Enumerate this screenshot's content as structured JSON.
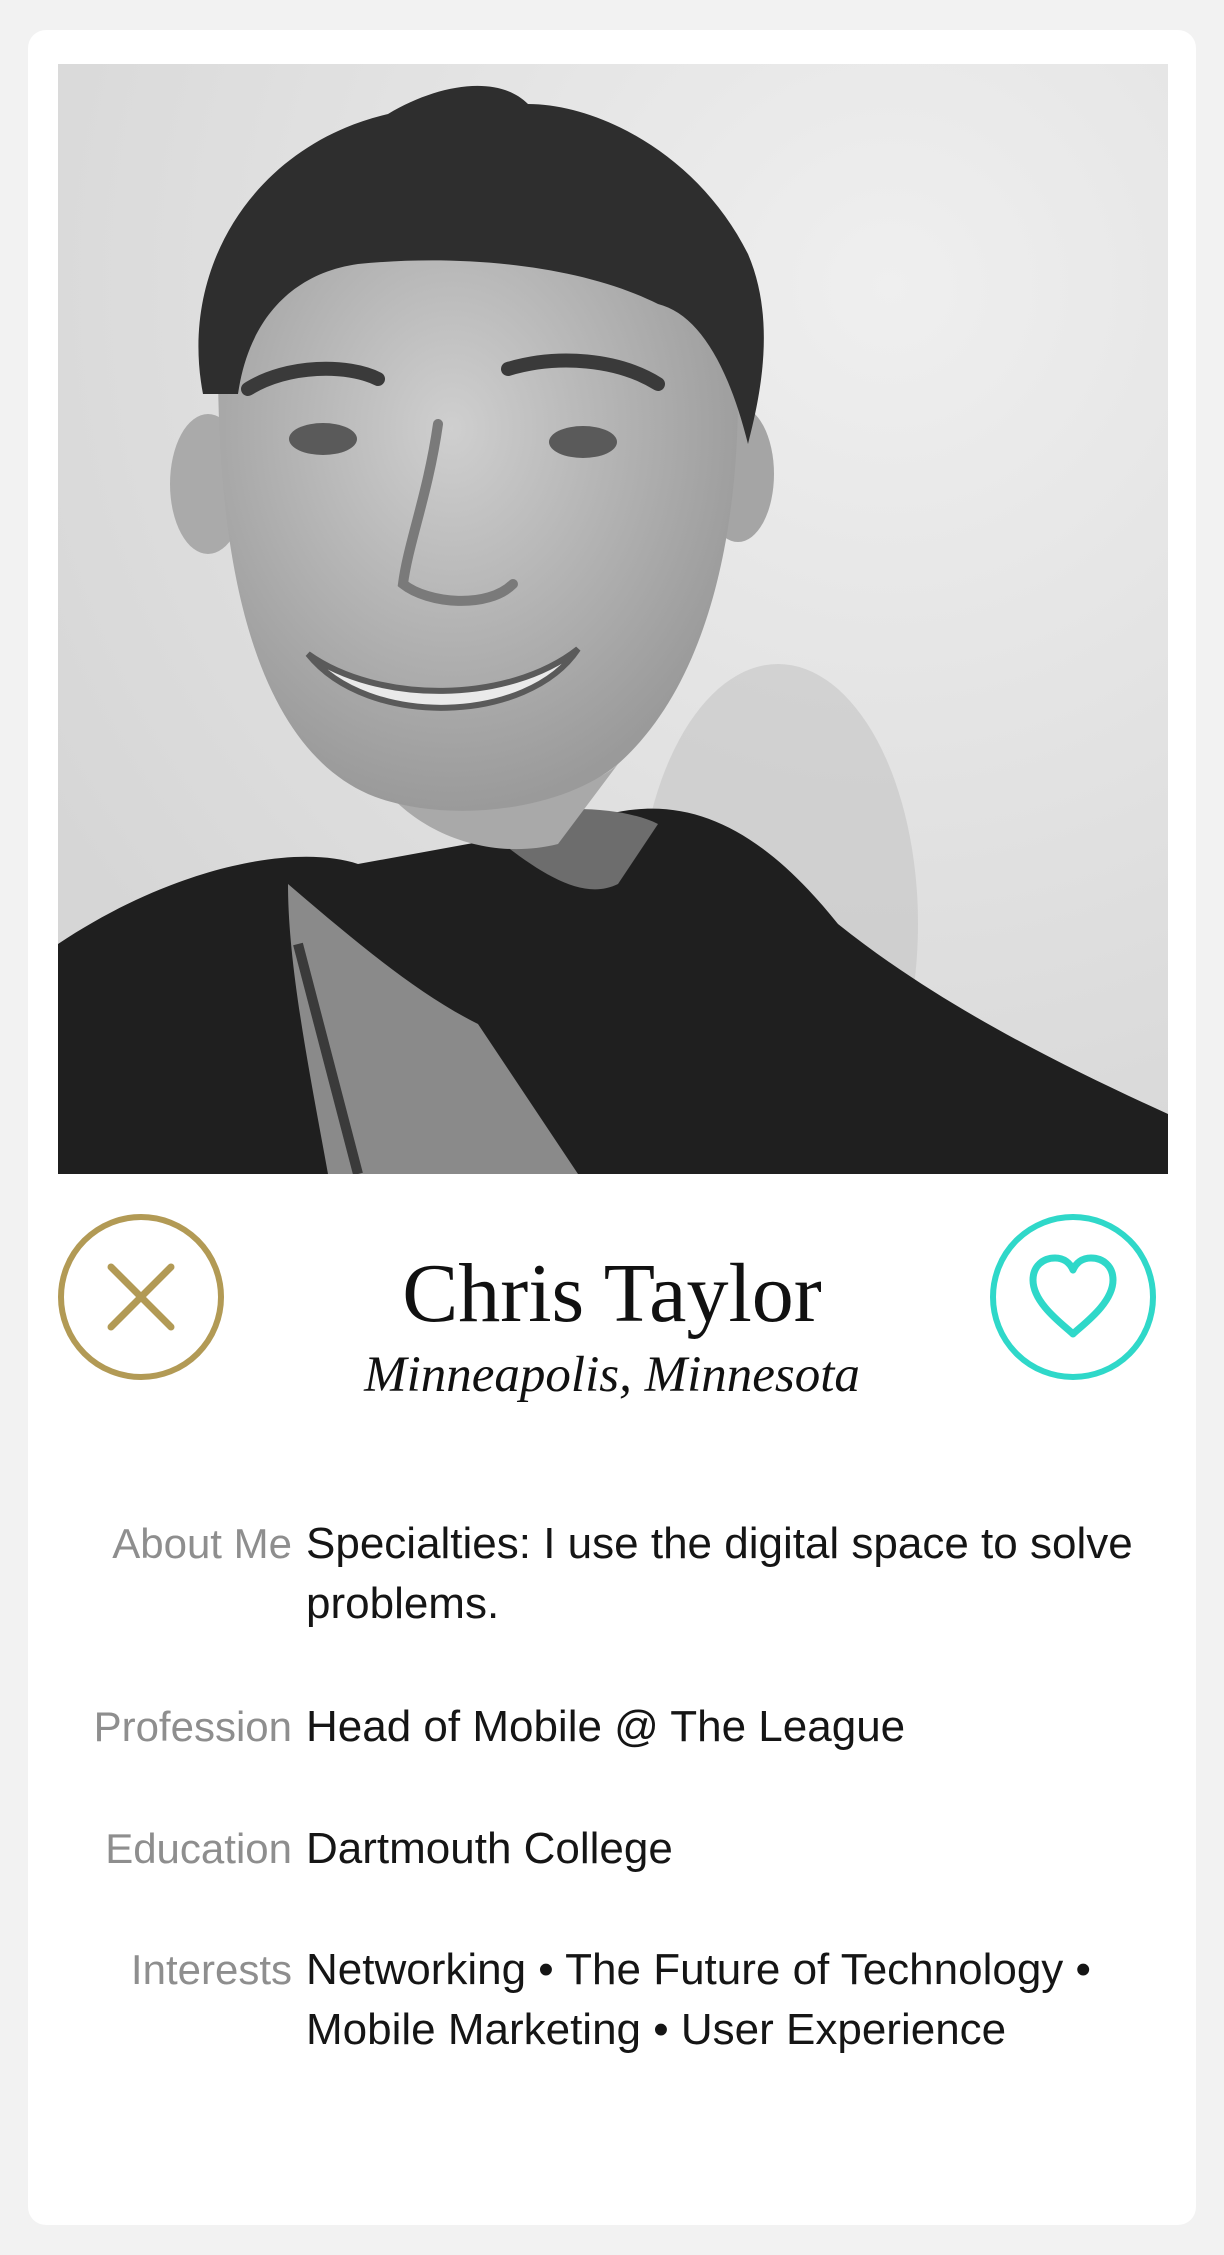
{
  "profile": {
    "name": "Chris Taylor",
    "location": "Minneapolis, Minnesota"
  },
  "actions": {
    "pass_icon": "close-icon",
    "like_icon": "heart-icon",
    "pass_color": "#b29a55",
    "like_color": "#2fd8c9"
  },
  "details": [
    {
      "label": "About Me",
      "value": "Specialties: I use the digital space to solve problems."
    },
    {
      "label": "Profession",
      "value": "Head of Mobile @ The League"
    },
    {
      "label": "Education",
      "value": "Dartmouth College"
    },
    {
      "label": "Interests",
      "value": "Networking • The Future of Technology • Mobile Marketing • User Experience"
    }
  ],
  "colors": {
    "background": "#f2f2f2",
    "card": "#ffffff",
    "label": "#8e8e8e",
    "text": "#151515"
  }
}
